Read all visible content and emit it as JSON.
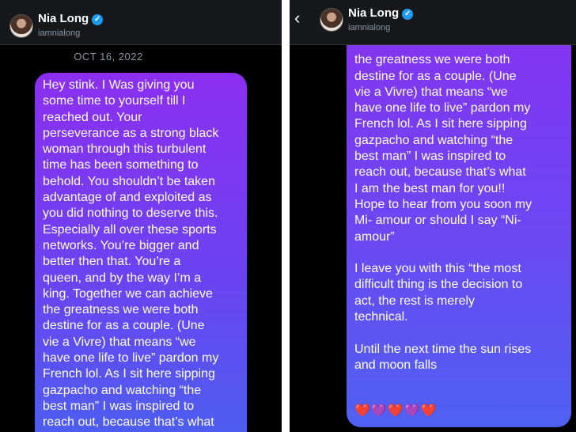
{
  "left": {
    "header": {
      "name": "Nia Long",
      "handle": "iamnialong"
    },
    "date": "OCT 16, 2022",
    "message": "Hey stink. I Was giving you\nsome time to yourself till I\nreached out. Your\nperseverance as a strong black\nwoman through this turbulent\ntime has been something to\nbehold. You shouldn’t  be taken\nadvantage of and exploited as\nyou did nothing to deserve this.\nEspecially all over these sports\nnetworks. You’re bigger and\nbetter then that. You’re a\nqueen, and by the way I’m a\nking. Together we can achieve\nthe greatness we were both\ndestine for as a couple. (Une\nvie a Vivre) that means “we\nhave one life to live” pardon my\nFrench lol. As I sit here sipping\ngazpacho and watching “the\nbest man” I was inspired to\nreach out, because that’s what"
  },
  "right": {
    "header": {
      "name": "Nia Long",
      "handle": "iamnialong",
      "back_icon": "‹"
    },
    "message": "the greatness we were both\ndestine for as a couple. (Une\nvie a Vivre) that means “we\nhave one life to live” pardon my\nFrench lol. As I sit here sipping\ngazpacho and watching “the\nbest man” I was inspired to\nreach out, because that’s what\nI am the best man for you!!\nHope to hear from you soon my\nMi- amour or should I say “Ni-\namour”\n\nI leave you with this “the most\ndifficult thing is the decision to\nact, the rest is merely\ntechnical.\n\nUntil the next time the sun rises\nand moon falls",
    "emojis": "❤️💜❤️💜❤️"
  },
  "colors": {
    "background": "#000000",
    "bubble_top": "#8c2ef0",
    "bubble_bottom": "#4a60f0",
    "verified": "#1d9bf0"
  }
}
